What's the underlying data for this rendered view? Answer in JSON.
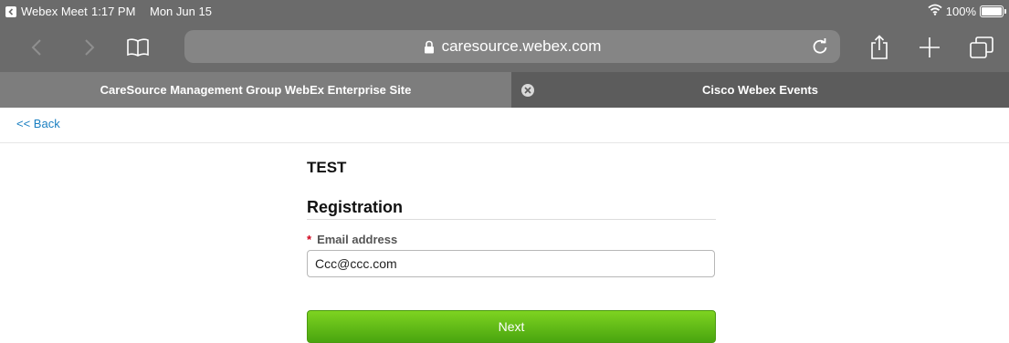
{
  "status_bar": {
    "back_app": "Webex Meet",
    "time": "1:17 PM",
    "date": "Mon Jun 15",
    "battery": "100%",
    "battery_level": 1.0,
    "wifi_icon": "wifi-icon"
  },
  "browser": {
    "url": "caresource.webex.com",
    "icons": [
      "back-icon",
      "forward-icon",
      "bookmarks-icon",
      "lock-icon",
      "reload-icon",
      "share-icon",
      "new-tab-icon",
      "tabs-icon"
    ],
    "tabs": [
      {
        "label": "CareSource Management Group WebEx Enterprise Site",
        "active": true
      },
      {
        "label": "Cisco Webex Events",
        "active": false
      }
    ]
  },
  "page": {
    "back_link": "<< Back",
    "event_title": "TEST",
    "section_title": "Registration",
    "required_marker": "*",
    "email_label": "Email address",
    "email_value": "Ccc@ccc.com",
    "next_label": "Next"
  },
  "colors": {
    "chrome": "#6b6b6b",
    "link": "#1a7fc1",
    "button_green": "#6cc11c",
    "required": "#d0021b"
  }
}
